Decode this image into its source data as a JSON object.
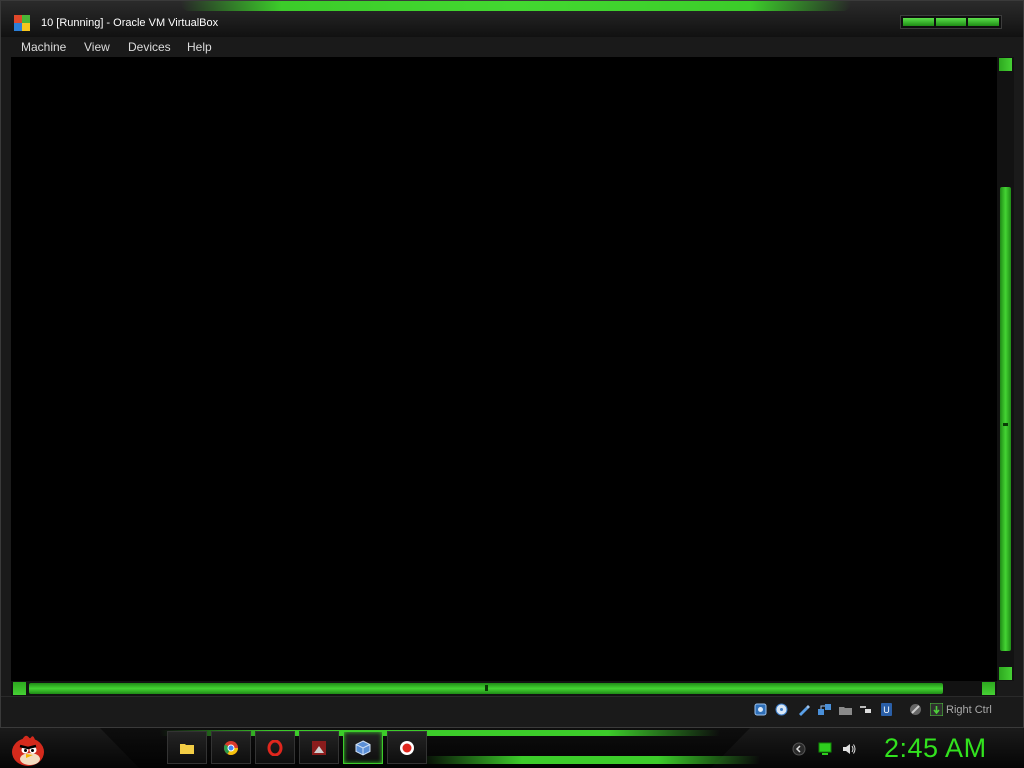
{
  "window": {
    "title": "10 [Running] - Oracle VM VirtualBox"
  },
  "menu": {
    "items": [
      "Machine",
      "View",
      "Devices",
      "Help"
    ]
  },
  "statusbar": {
    "icons": [
      "hard-disk-icon",
      "optical-drive-icon",
      "usb-pen-icon",
      "network-icon",
      "shared-folders-icon",
      "display-icon",
      "usb-icon",
      "mouse-integration-icon",
      "keyboard-capture-icon"
    ],
    "host_key": "Right Ctrl"
  },
  "taskbar": {
    "start": "start-button",
    "apps": [
      "file-explorer-icon",
      "chrome-icon",
      "opera-icon",
      "photo-viewer-icon",
      "virtualbox-icon",
      "record-icon"
    ],
    "tray_icons": [
      "show-hidden-icons-icon",
      "network-monitor-icon",
      "volume-icon"
    ],
    "clock": "2:45 AM"
  },
  "colors": {
    "accent_green": "#3ccc2a",
    "clock_green": "#32e21e",
    "background": "#000000"
  }
}
